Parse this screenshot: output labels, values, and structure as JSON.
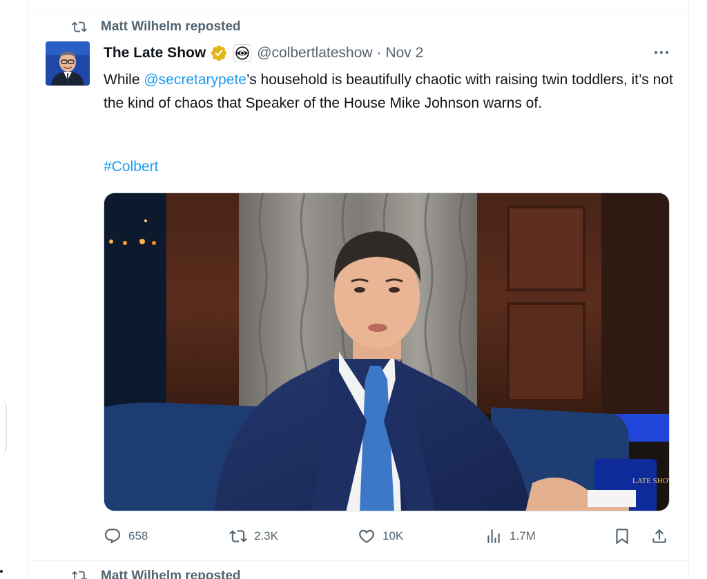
{
  "repost": {
    "text": "Matt Wilhelm reposted"
  },
  "post": {
    "display_name": "The Late Show",
    "handle": "@colbertlateshow",
    "separator": "·",
    "date": "Nov 2",
    "body": {
      "part1": "While ",
      "mention": "@secretarypete",
      "part2": "’s household is beautifully chaotic with raising twin toddlers, it’s not the kind of chaos that Speaker of the House Mike Johnson warns of."
    },
    "hashtag": "#Colbert",
    "media_caption_logo": "LATE SHOW"
  },
  "actions": {
    "replies": "658",
    "reposts": "2.3K",
    "likes": "10K",
    "views": "1.7M"
  },
  "next_repost": {
    "text": "Matt Wilhelm reposted"
  },
  "colors": {
    "link": "#1d9bf0",
    "secondary_text": "#536471",
    "verified_gold": "#e2b719"
  }
}
